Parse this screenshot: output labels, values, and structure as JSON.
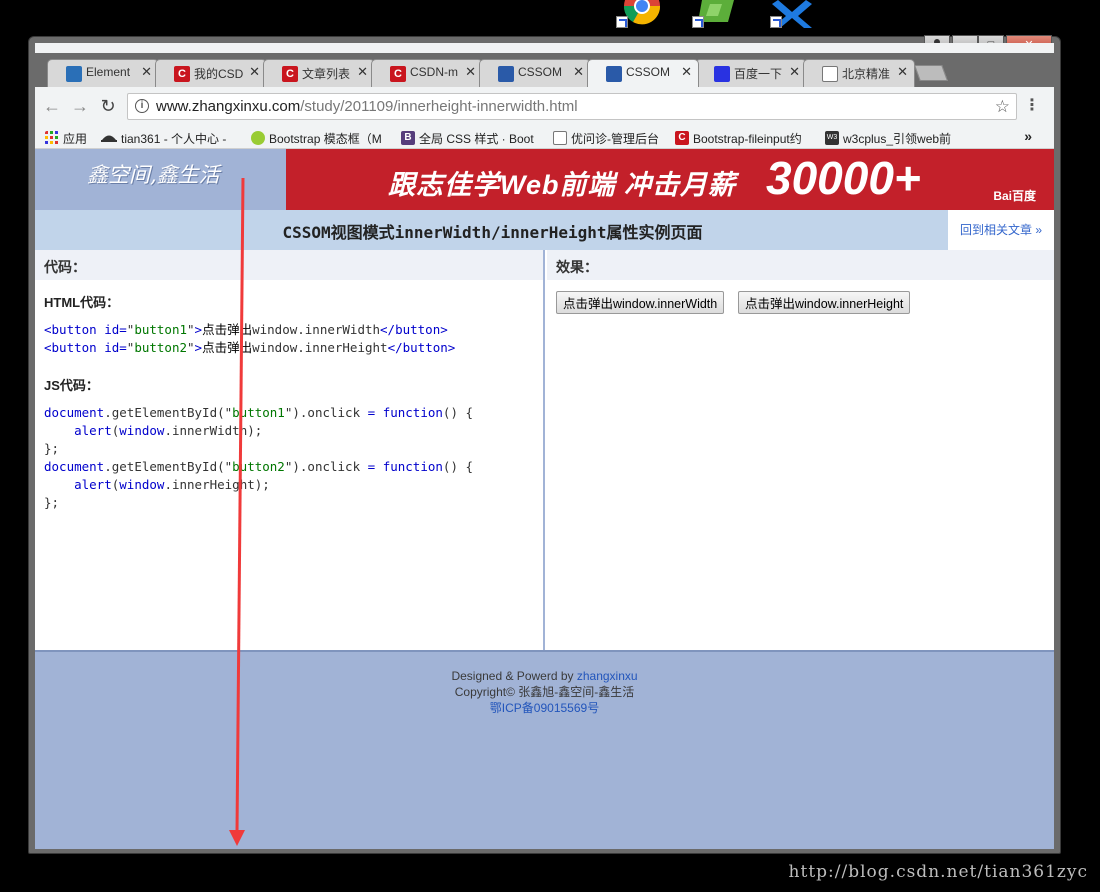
{
  "window": {
    "controls": {
      "minimize": "–",
      "maximize": "□",
      "close": "✕",
      "user": "⏶"
    }
  },
  "tabs": [
    {
      "label": "Element",
      "icon": "elements-icon"
    },
    {
      "label": "我的CSD",
      "icon": "csdn-icon"
    },
    {
      "label": "文章列表",
      "icon": "csdn-icon"
    },
    {
      "label": "CSDN-m",
      "icon": "csdn-icon"
    },
    {
      "label": "CSSOM",
      "icon": "zhangxinxu-icon"
    },
    {
      "label": "CSSOM",
      "icon": "zhangxinxu-icon",
      "active": true
    },
    {
      "label": "百度一下",
      "icon": "baidu-icon"
    },
    {
      "label": "北京精准",
      "icon": "document-icon"
    }
  ],
  "address": {
    "host": "www.zhangxinxu.com",
    "path": "/study/201109/innerheight-innerwidth.html"
  },
  "bookmarks": [
    {
      "label": "应用",
      "icon": "apps-grid-icon"
    },
    {
      "label": "tian361 - 个人中心 -",
      "icon": "hat-icon"
    },
    {
      "label": "Bootstrap 模态框（M",
      "icon": "bootstrap-green-icon"
    },
    {
      "label": "全局 CSS 样式 · Boot",
      "icon": "bootstrap-b-icon"
    },
    {
      "label": "优问诊-管理后台",
      "icon": "document-icon"
    },
    {
      "label": "Bootstrap-fileinput约",
      "icon": "csdn-icon"
    },
    {
      "label": "w3cplus_引领web前",
      "icon": "w3cplus-icon"
    }
  ],
  "bookmarks_more": "»",
  "banner": {
    "logo": "鑫空间,鑫生活",
    "ad_text": "跟志佳学Web前端  冲击月薪",
    "ad_big": "30000+",
    "ad_brand": "Bai百度"
  },
  "page_title": "CSSOM视图模式innerWidth/innerHeight属性实例页面",
  "back_link": "回到相关文章 »",
  "code_col": {
    "heading": "代码：",
    "html_label": "HTML代码：",
    "js_label": "JS代码："
  },
  "effect_col": {
    "heading": "效果：",
    "btn1": "点击弹出window.innerWidth",
    "btn2": "点击弹出window.innerHeight"
  },
  "footer": {
    "line1_prefix": "Designed & Powerd by ",
    "line1_link": "zhangxinxu",
    "line2": "Copyright© 张鑫旭-鑫空间-鑫生活",
    "line3": "鄂ICP备09015569号"
  },
  "watermark": "http://blog.csdn.net/tian361zyc",
  "colors": {
    "banner": "#a1b3d6",
    "ad": "#c3202a",
    "titlebar": "#c1d4ea",
    "arrow": "#f03a3a"
  }
}
